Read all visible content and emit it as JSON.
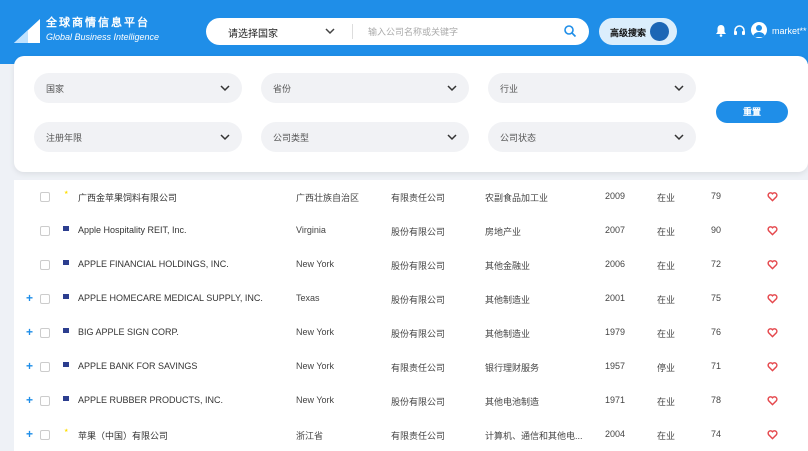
{
  "header": {
    "brand_cn": "全球商情信息平台",
    "brand_en": "Global Business Intelligence",
    "country_select": "请选择国家",
    "search_placeholder": "输入公司名称或关键字",
    "advanced_search": "高级搜索",
    "username": "market**",
    "colors": {
      "primary": "#1f8ee8",
      "toggle_knob": "#1c66b5"
    }
  },
  "filters": {
    "country": "国家",
    "province": "省份",
    "industry": "行业",
    "established": "注册年限",
    "company_type": "公司类型",
    "company_status": "公司状态",
    "reset": "重置"
  },
  "rows": [
    {
      "expand": "",
      "flag": "cn",
      "name": "广西金苹果饲料有限公司",
      "region": "广西壮族自治区",
      "type": "有限责任公司",
      "industry": "农副食品加工业",
      "year": "2009",
      "status": "在业",
      "score": "79"
    },
    {
      "expand": "",
      "flag": "us",
      "name": "Apple Hospitality REIT, Inc.",
      "region": "Virginia",
      "type": "股份有限公司",
      "industry": "房地产业",
      "year": "2007",
      "status": "在业",
      "score": "90"
    },
    {
      "expand": "",
      "flag": "us",
      "name": "APPLE FINANCIAL HOLDINGS, INC.",
      "region": "New York",
      "type": "股份有限公司",
      "industry": "其他金融业",
      "year": "2006",
      "status": "在业",
      "score": "72"
    },
    {
      "expand": "+",
      "flag": "us",
      "name": "APPLE HOMECARE MEDICAL SUPPLY, INC.",
      "region": "Texas",
      "type": "股份有限公司",
      "industry": "其他制造业",
      "year": "2001",
      "status": "在业",
      "score": "75"
    },
    {
      "expand": "+",
      "flag": "us",
      "name": "BIG APPLE SIGN CORP.",
      "region": "New York",
      "type": "股份有限公司",
      "industry": "其他制造业",
      "year": "1979",
      "status": "在业",
      "score": "76"
    },
    {
      "expand": "+",
      "flag": "us",
      "name": "APPLE BANK FOR SAVINGS",
      "region": "New York",
      "type": "有限责任公司",
      "industry": "银行理财服务",
      "year": "1957",
      "status": "停业",
      "score": "71"
    },
    {
      "expand": "+",
      "flag": "us",
      "name": "APPLE RUBBER PRODUCTS, INC.",
      "region": "New York",
      "type": "股份有限公司",
      "industry": "其他电池制造",
      "year": "1971",
      "status": "在业",
      "score": "78"
    },
    {
      "expand": "+",
      "flag": "cn",
      "name": "苹果（中国）有限公司",
      "region": "浙江省",
      "type": "有限责任公司",
      "industry": "计算机、通信和其他电...",
      "year": "2004",
      "status": "在业",
      "score": "74"
    }
  ],
  "icons": {
    "logo": "triangle-logo-icon",
    "search": "search-icon",
    "bell": "bell-icon",
    "headset": "headset-icon",
    "avatar": "user-avatar-icon",
    "favorite": "heart-icon",
    "favorite_color": "#e5484d"
  }
}
